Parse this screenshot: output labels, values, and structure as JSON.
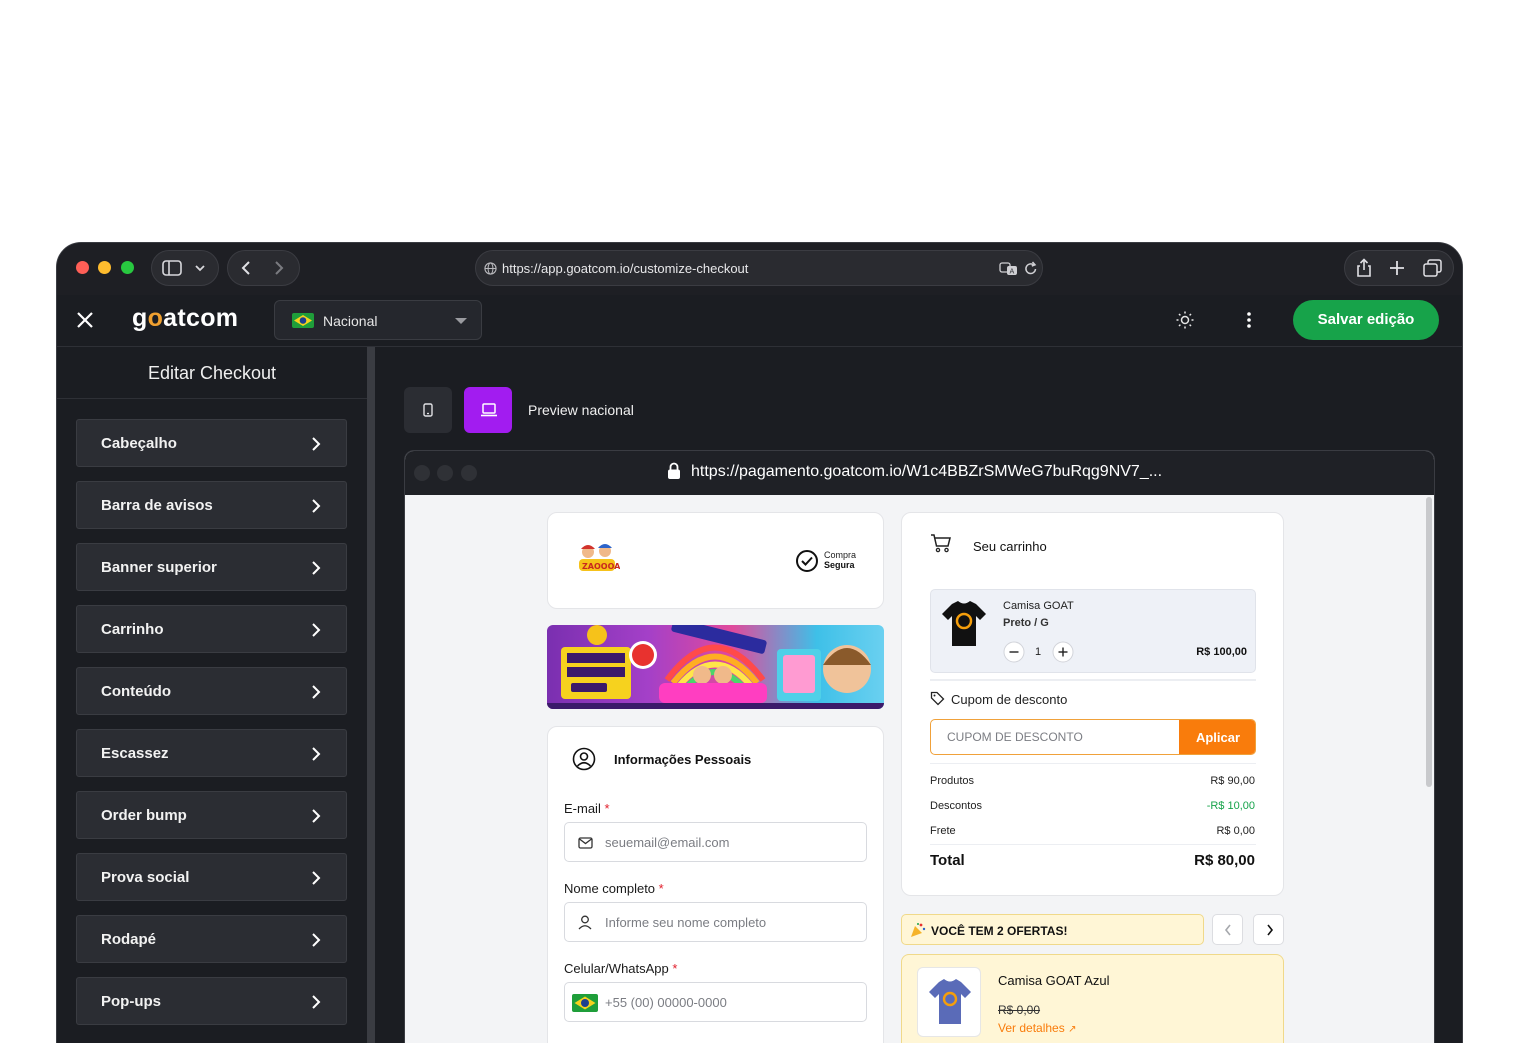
{
  "browser": {
    "url": "https://app.goatcom.io/customize-checkout"
  },
  "header": {
    "logo": "goatcom",
    "logo_pre": "g",
    "logo_o": "o",
    "logo_post": "atcom",
    "country": "Nacional",
    "save_label": "Salvar edição"
  },
  "sidebar": {
    "title": "Editar Checkout",
    "items": [
      {
        "label": "Cabeçalho"
      },
      {
        "label": "Barra de avisos"
      },
      {
        "label": "Banner superior"
      },
      {
        "label": "Carrinho"
      },
      {
        "label": "Conteúdo"
      },
      {
        "label": "Escassez"
      },
      {
        "label": "Order bump"
      },
      {
        "label": "Prova social"
      },
      {
        "label": "Rodapé"
      },
      {
        "label": "Pop-ups"
      }
    ]
  },
  "preview": {
    "label": "Preview nacional",
    "url": "https://pagamento.goatcom.io/W1c4BBZrSMWeG7buRqg9NV7_...",
    "store": {
      "secure_line1": "Compra",
      "secure_line2": "Segura"
    },
    "personal": {
      "title": "Informações Pessoais",
      "email_label": "E-mail",
      "email_placeholder": "seuemail@email.com",
      "name_label": "Nome completo",
      "name_placeholder": "Informe seu nome completo",
      "phone_label": "Celular/WhatsApp",
      "phone_placeholder": "+55 (00) 00000-0000",
      "required_mark": "*"
    },
    "cart": {
      "title": "Seu carrinho",
      "product_name": "Camisa GOAT",
      "product_variant": "Preto / G",
      "quantity": "1",
      "product_price": "R$ 100,00",
      "coupon_label": "Cupom de desconto",
      "coupon_placeholder": "CUPOM DE DESCONTO",
      "apply_label": "Aplicar",
      "summary": [
        {
          "label": "Produtos",
          "value": "R$ 90,00"
        },
        {
          "label": "Descontos",
          "value": "-R$ 10,00"
        },
        {
          "label": "Frete",
          "value": "R$ 0,00"
        }
      ],
      "total_label": "Total",
      "total_value": "R$ 80,00"
    },
    "offers": {
      "title": "VOCÊ TEM 2 OFERTAS!",
      "item_name": "Camisa GOAT Azul",
      "item_old_price": "R$ 0,00",
      "item_link": "Ver detalhes"
    }
  },
  "colors": {
    "accent_save": "#17a34a",
    "accent_purple": "#a21cf0",
    "accent_orange": "#f97c0c",
    "discount_green": "#16a34a"
  }
}
